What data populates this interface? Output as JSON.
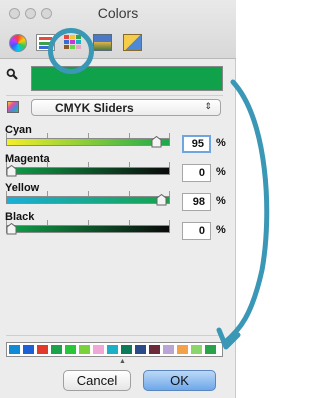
{
  "window": {
    "title": "Colors"
  },
  "toolbar": {
    "modes": [
      "color-wheel",
      "color-sliders",
      "color-palettes",
      "image-palettes",
      "crayons"
    ],
    "selected": "color-sliders"
  },
  "current_color": "#0fa24a",
  "mode_popup": {
    "label": "CMYK Sliders",
    "arrows": "⇕"
  },
  "sliders": [
    {
      "label": "Cyan",
      "value": "95",
      "unit": "%",
      "level": 0.95,
      "gradient": [
        "#f4ef2a",
        "#1ba84b"
      ]
    },
    {
      "label": "Magenta",
      "value": "0",
      "unit": "%",
      "level": 0.0,
      "gradient": [
        "#0fa24a",
        "#0a0a0a"
      ]
    },
    {
      "label": "Yellow",
      "value": "98",
      "unit": "%",
      "level": 0.98,
      "gradient": [
        "#1ab0d8",
        "#15a24a"
      ]
    },
    {
      "label": "Black",
      "value": "0",
      "unit": "%",
      "level": 0.0,
      "gradient": [
        "#0fa24a",
        "#0a0a0a"
      ]
    }
  ],
  "swatches": [
    "#0f8ad6",
    "#1c5fd6",
    "#e23a2a",
    "#1ca24a",
    "#2ac63a",
    "#7ad13c",
    "#f0a8d6",
    "#1ab0c8",
    "#0f7a5a",
    "#2a4a8a",
    "#6a2a3a",
    "#b9a6d6",
    "#f3a24a",
    "#8ad66a",
    "#2aa24a"
  ],
  "buttons": {
    "cancel": "Cancel",
    "ok": "OK"
  },
  "annotation": {
    "color": "#3a97b5"
  }
}
